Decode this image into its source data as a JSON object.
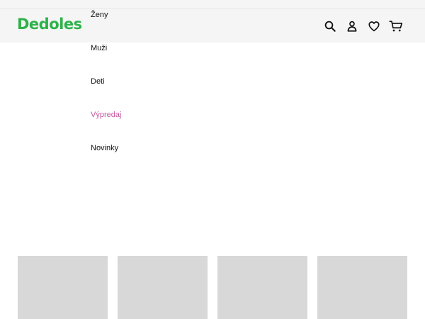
{
  "brand": {
    "logo_text": "Dedoles",
    "color": "#2db24a"
  },
  "nav": {
    "items": [
      {
        "label": "Ženy"
      },
      {
        "label": "Muži"
      },
      {
        "label": "Deti"
      },
      {
        "label": "Výpredaj",
        "accent": "#c6559e"
      },
      {
        "label": "Novinky"
      }
    ]
  },
  "header_actions": [
    {
      "icon": "search-icon"
    },
    {
      "icon": "user-icon"
    },
    {
      "icon": "heart-icon"
    },
    {
      "icon": "cart-icon"
    }
  ],
  "product_cards": {
    "count": 4,
    "placeholder_color": "#d8d8d8"
  }
}
